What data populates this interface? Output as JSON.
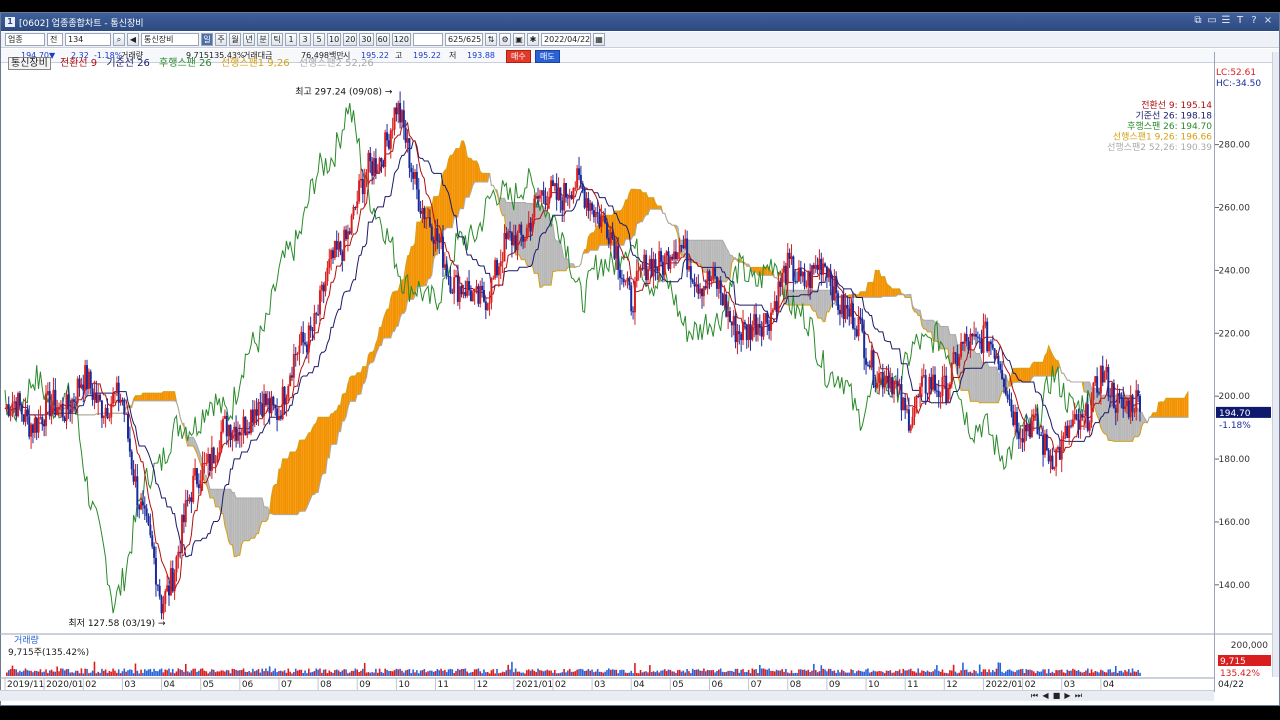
{
  "window": {
    "title": "[0602] 업종종합차트 - 통신장비",
    "app_icon": "1",
    "controls": [
      "⧉",
      "▭",
      "☰",
      "T",
      "?",
      "×"
    ]
  },
  "toolbar": {
    "market": "업종",
    "period_type": "전",
    "code": "134",
    "name": "통신장비",
    "unit": "일",
    "period_buttons": [
      "주",
      "월",
      "년",
      "분",
      "틱"
    ],
    "minute_buttons": [
      "1",
      "3",
      "5",
      "10",
      "20",
      "30",
      "60",
      "120"
    ],
    "count": "625/625",
    "date": "2022/04/22"
  },
  "infobar": {
    "price": "194.70▼",
    "change": "2.32",
    "change_pct": "-1.18%",
    "volume_label": "거래량",
    "volume": "9,715",
    "volume_pct": "135.43%",
    "amount_label": "거래대금",
    "amount": "76,498백만",
    "open_label": "시",
    "open": "195.22",
    "high_label": "고",
    "high": "195.22",
    "low_label": "저",
    "low": "193.88",
    "buy": "매수",
    "sell": "매도"
  },
  "series_title": {
    "name": "통신장비",
    "indicators": [
      {
        "label": "전환선 9",
        "color": "#b01010"
      },
      {
        "label": "기준선 26",
        "color": "#1a1a6a"
      },
      {
        "label": "후행스팬 26",
        "color": "#2a8a2a"
      },
      {
        "label": "선행스팬1 9,26",
        "color": "#d4a017"
      },
      {
        "label": "선행스팬2 52,26",
        "color": "#aaaaaa"
      }
    ]
  },
  "right_readout": {
    "lc": "LC:52.61",
    "hc": "HC:-34.50",
    "lines": [
      {
        "label": "전환선 9: 195.14",
        "color": "#b01010"
      },
      {
        "label": "기준선 26: 198.18",
        "color": "#1a1a6a"
      },
      {
        "label": "후행스팬 26: 194.70",
        "color": "#2a8a2a"
      },
      {
        "label": "선행스팬1 9,26: 196.66",
        "color": "#d4a017"
      },
      {
        "label": "선행스팬2 52,26: 190.39",
        "color": "#aaaaaa"
      }
    ],
    "current_price": "194.70",
    "current_change": "-1.18%",
    "volume_axis": "200,000",
    "volume_value": "9,715",
    "volume_pct": "135.42%",
    "date_label": "04/22"
  },
  "volume_panel": {
    "title": "거래량",
    "value_text": "9,715주(135.42%)"
  },
  "annotations": {
    "high": "최고 297.24 (09/08)",
    "low": "최저 127.58 (03/19)"
  },
  "chart_data": {
    "type": "line",
    "title": "통신장비",
    "xlabel": "",
    "ylabel": "",
    "ylim": [
      125,
      305
    ],
    "y_ticks": [
      140,
      160,
      180,
      200,
      220,
      240,
      260,
      280
    ],
    "x_tick_labels": [
      "2019/11",
      "2020/01",
      "02",
      "03",
      "04",
      "05",
      "06",
      "07",
      "08",
      "09",
      "10",
      "11",
      "12",
      "2021/01",
      "02",
      "03",
      "04",
      "05",
      "06",
      "07",
      "08",
      "09",
      "10",
      "11",
      "12",
      "2022/01",
      "02",
      "03",
      "04"
    ],
    "high": {
      "value": 297.24,
      "date": "09/08"
    },
    "low": {
      "value": 127.58,
      "date": "03/19"
    },
    "close": [
      [
        "2019/11",
        196
      ],
      [
        "2019/12",
        193
      ],
      [
        "2020/01",
        203
      ],
      [
        "2020/02",
        196
      ],
      [
        "2020/03",
        133
      ],
      [
        "2020/04",
        178
      ],
      [
        "2020/05",
        193
      ],
      [
        "2020/06",
        198
      ],
      [
        "2020/07",
        228
      ],
      [
        "2020/08",
        262
      ],
      [
        "2020/09",
        290
      ],
      [
        "2020/10",
        248
      ],
      [
        "2020/11",
        228
      ],
      [
        "2020/12",
        250
      ],
      [
        "2021/01",
        266
      ],
      [
        "2021/02",
        264
      ],
      [
        "2021/03",
        233
      ],
      [
        "2021/04",
        248
      ],
      [
        "2021/05",
        236
      ],
      [
        "2021/06",
        218
      ],
      [
        "2021/07",
        238
      ],
      [
        "2021/08",
        240
      ],
      [
        "2021/09",
        215
      ],
      [
        "2021/10",
        196
      ],
      [
        "2021/11",
        205
      ],
      [
        "2021/12",
        222
      ],
      [
        "2022/01",
        190
      ],
      [
        "2022/02",
        182
      ],
      [
        "2022/03",
        204
      ],
      [
        "2022/04",
        195
      ]
    ],
    "volume_ylim": [
      0,
      200000
    ],
    "last_volume": 9715
  }
}
